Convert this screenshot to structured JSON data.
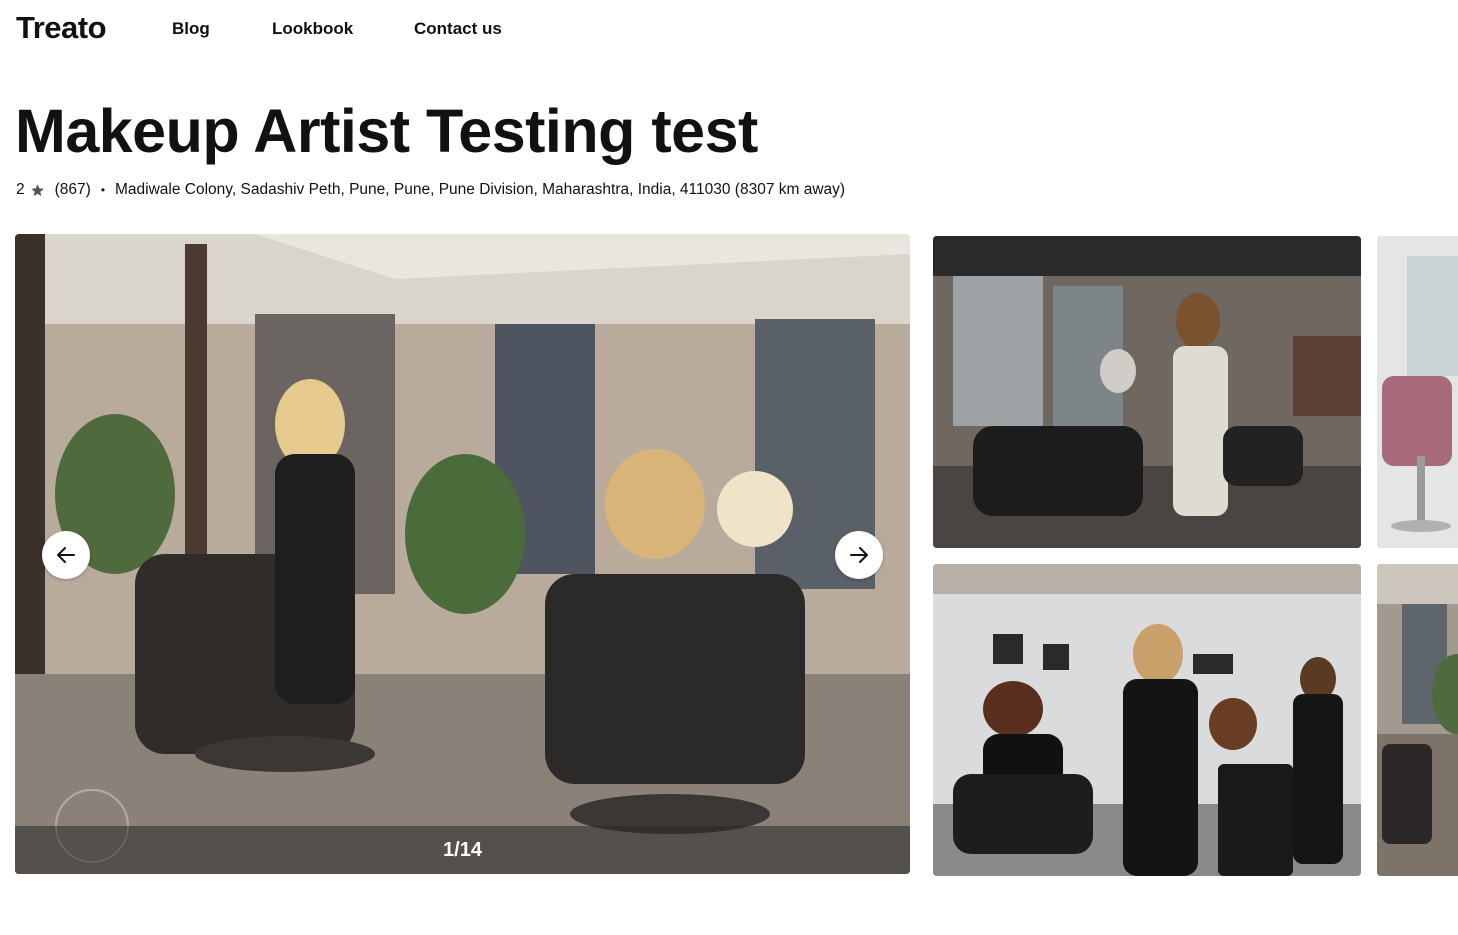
{
  "nav": {
    "logo": "Treato",
    "links": [
      "Blog",
      "Lookbook",
      "Contact us"
    ]
  },
  "listing": {
    "title": "Makeup Artist Testing test",
    "rating": "2",
    "review_count": "(867)",
    "separator": "•",
    "address": "Madiwale Colony, Sadashiv Peth, Pune, Pune, Pune Division, Maharashtra, India, 411030 (8307 km away)"
  },
  "gallery": {
    "counter": "1/14",
    "images": [
      {
        "name": "salon-interior-main"
      },
      {
        "name": "salon-stylist-thumbnail"
      },
      {
        "name": "salon-chair-thumbnail"
      },
      {
        "name": "salon-curly-hair-thumbnail"
      },
      {
        "name": "salon-mirror-thumbnail"
      }
    ]
  },
  "colors": {
    "text": "#111111",
    "star": "#555555",
    "counter_bar": "#282828"
  },
  "icons": {
    "rating": "star-icon",
    "previous": "arrow-left-icon",
    "next": "arrow-right-icon"
  }
}
